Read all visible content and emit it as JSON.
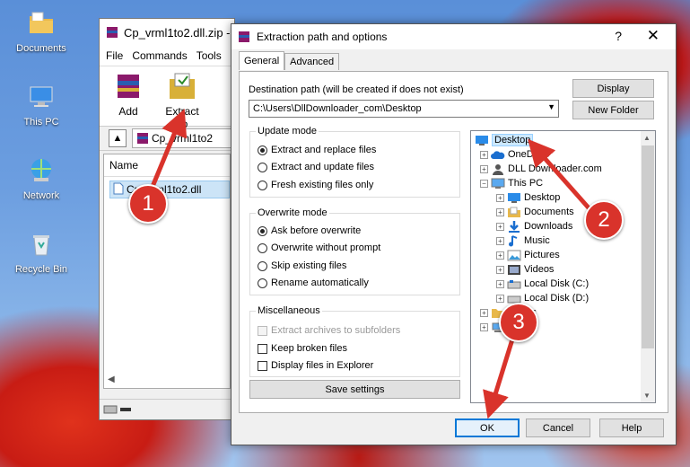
{
  "desktop": {
    "icons": [
      {
        "label": "Documents"
      },
      {
        "label": "This PC"
      },
      {
        "label": "Network"
      },
      {
        "label": "Recycle Bin"
      }
    ]
  },
  "winrar": {
    "title": "Cp_vrml1to2.dll.zip -",
    "menu": [
      "File",
      "Commands",
      "Tools"
    ],
    "toolbar": {
      "add": "Add",
      "extract": "Extract To"
    },
    "path": "Cp_vrml1to2",
    "column_name": "Name",
    "file": "Cp_vrml1to2.dll"
  },
  "dialog": {
    "title": "Extraction path and options",
    "help_glyph": "?",
    "close_glyph": "✕",
    "tabs": [
      "General",
      "Advanced"
    ],
    "dest_label": "Destination path (will be created if does not exist)",
    "dest_value": "C:\\Users\\DllDownloader_com\\Desktop",
    "display_button": "Display",
    "new_folder_button": "New Folder",
    "update_mode": {
      "title": "Update mode",
      "options": [
        "Extract and replace files",
        "Extract and update files",
        "Fresh existing files only"
      ],
      "selected": 0
    },
    "overwrite_mode": {
      "title": "Overwrite mode",
      "options": [
        "Ask before overwrite",
        "Overwrite without prompt",
        "Skip existing files",
        "Rename automatically"
      ],
      "selected": 0
    },
    "misc": {
      "title": "Miscellaneous",
      "options": [
        "Extract archives to subfolders",
        "Keep broken files",
        "Display files in Explorer"
      ]
    },
    "save_settings": "Save settings",
    "tree": [
      {
        "label": "Desktop",
        "icon": "desktop-icon",
        "selected": true
      },
      {
        "label": "OneDrive",
        "icon": "cloud-icon"
      },
      {
        "label": "DLL Downloader.com",
        "icon": "user-icon"
      },
      {
        "label": "This PC",
        "icon": "computer-icon"
      },
      {
        "label": "Desktop",
        "icon": "desktop-icon"
      },
      {
        "label": "Documents",
        "icon": "folder-icon"
      },
      {
        "label": "Downloads",
        "icon": "download-icon"
      },
      {
        "label": "Music",
        "icon": "music-icon"
      },
      {
        "label": "Pictures",
        "icon": "pictures-icon"
      },
      {
        "label": "Videos",
        "icon": "video-icon"
      },
      {
        "label": "Local Disk (C:)",
        "icon": "drive-icon"
      },
      {
        "label": "Local Disk (D:)",
        "icon": "drive-icon"
      },
      {
        "label": "ies",
        "icon": "folder-icon"
      },
      {
        "label": "rk",
        "icon": "network-icon"
      }
    ],
    "ok": "OK",
    "cancel": "Cancel",
    "help": "Help"
  },
  "callouts": [
    "1",
    "2",
    "3"
  ],
  "colors": {
    "callout": "#d9332b",
    "selection": "#cce8ff",
    "accent": "#0078d7"
  }
}
